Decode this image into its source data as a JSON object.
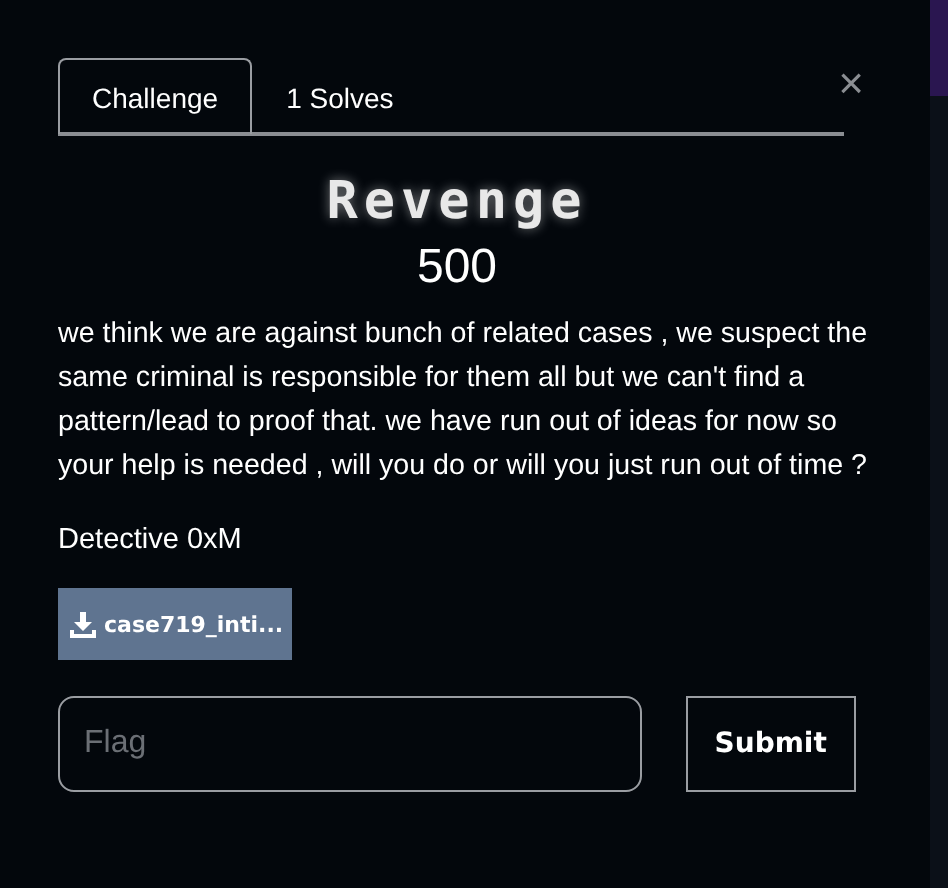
{
  "tabs": [
    {
      "label": "Challenge",
      "selected": true
    },
    {
      "label": "1 Solves",
      "selected": false
    }
  ],
  "close": "×",
  "title": "Revenge",
  "points": "500",
  "description": "we think we are against bunch of related cases , we suspect the same criminal is responsible for them all but we can't find a pattern/lead to proof that. we have run out of ideas for now so your help is needed , will you do or will you just run out of time ?",
  "author": "Detective 0xM",
  "file": "case719_inti...",
  "flag": {
    "placeholder": "Flag"
  },
  "submit": "Submit"
}
